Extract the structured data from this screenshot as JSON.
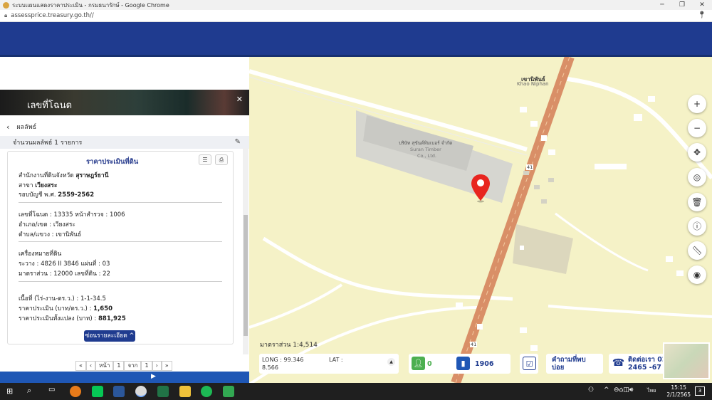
{
  "browser": {
    "window_title": "ระบบแผนแสดงราคาประเมิน - กรมธนารักษ์ - Google Chrome",
    "url": "assessprice.treasury.go.th//"
  },
  "panel": {
    "banner_title": "เลขที่โฉนด",
    "results_label": "ผลลัพธ์",
    "result_count": "จำนวนผลลัพธ์ 1 รายการ",
    "card": {
      "title": "ราคาประเมินที่ดิน",
      "office_line": "สำนักงานที่ดินจังหวัด",
      "office_value": "สุราษฎร์ธานี",
      "branch_line": "สาขา",
      "branch_value": "เวียงสระ",
      "period_line": "รอบบัญชี พ.ศ.",
      "period_value": "2559-2562",
      "deed_line": "เลขที่โฉนด : 13335 หน้าสำรวจ : 1006",
      "district_line": "อำเภอ/เขต : เวียงสระ",
      "subdistrict_line": "ตำบล/แขวง : เขานิพันธ์",
      "mark_heading": "เครื่องหมายที่ดิน",
      "mark_line1": "ระวาง : 4826 II 3846 แผ่นที่ : 03",
      "mark_line2": "มาตราส่วน : 12000 เลขที่ดิน : 22",
      "area_line": "เนื้อที่ (ไร่-งาน-ตร.ว.) : 1-1-34.5",
      "price_label": "ราคาประเมิน (บาท/ตร.ว.) :",
      "price_value": "1,650",
      "total_label": "ราคาประเมินทั้งแปลง (บาท) :",
      "total_value": "881,925",
      "less_button": "ซ่อนรายละเอียด ^"
    },
    "pager": {
      "first": "«",
      "prev": "‹",
      "page_label": "หน้า",
      "page": "1",
      "of_label": "จาก",
      "total": "1",
      "next": "›",
      "last": "»"
    }
  },
  "map": {
    "place_label_th": "เขานิพันธ์",
    "place_label_en": "Khao Niphan",
    "building_label_th": "บริษัท สุขันต์ทิมเบอร์ จำกัด",
    "building_label_en1": "Suran Timber",
    "building_label_en2": "Co., Ltd.",
    "road_number_1": "41",
    "road_number_2": "41",
    "scale": "มาตราส่วน 1:4,514",
    "long_label": "LONG : 99.346",
    "lat_label": "LAT :",
    "lat_value": "8.566",
    "users_count": "0",
    "stats_count": "1906",
    "faq_label": "คำถามที่พบบ่อย",
    "contact_label": "ติดต่อเรา 02 142 2465 -67",
    "controls": [
      "zoom-in",
      "zoom-out",
      "pan",
      "locate",
      "delete",
      "info",
      "measure",
      "compass"
    ],
    "accent_color": "#e8251f"
  },
  "taskbar": {
    "lang": "ไทย",
    "time": "15:15",
    "date": "2/1/2565",
    "notif": "3"
  }
}
